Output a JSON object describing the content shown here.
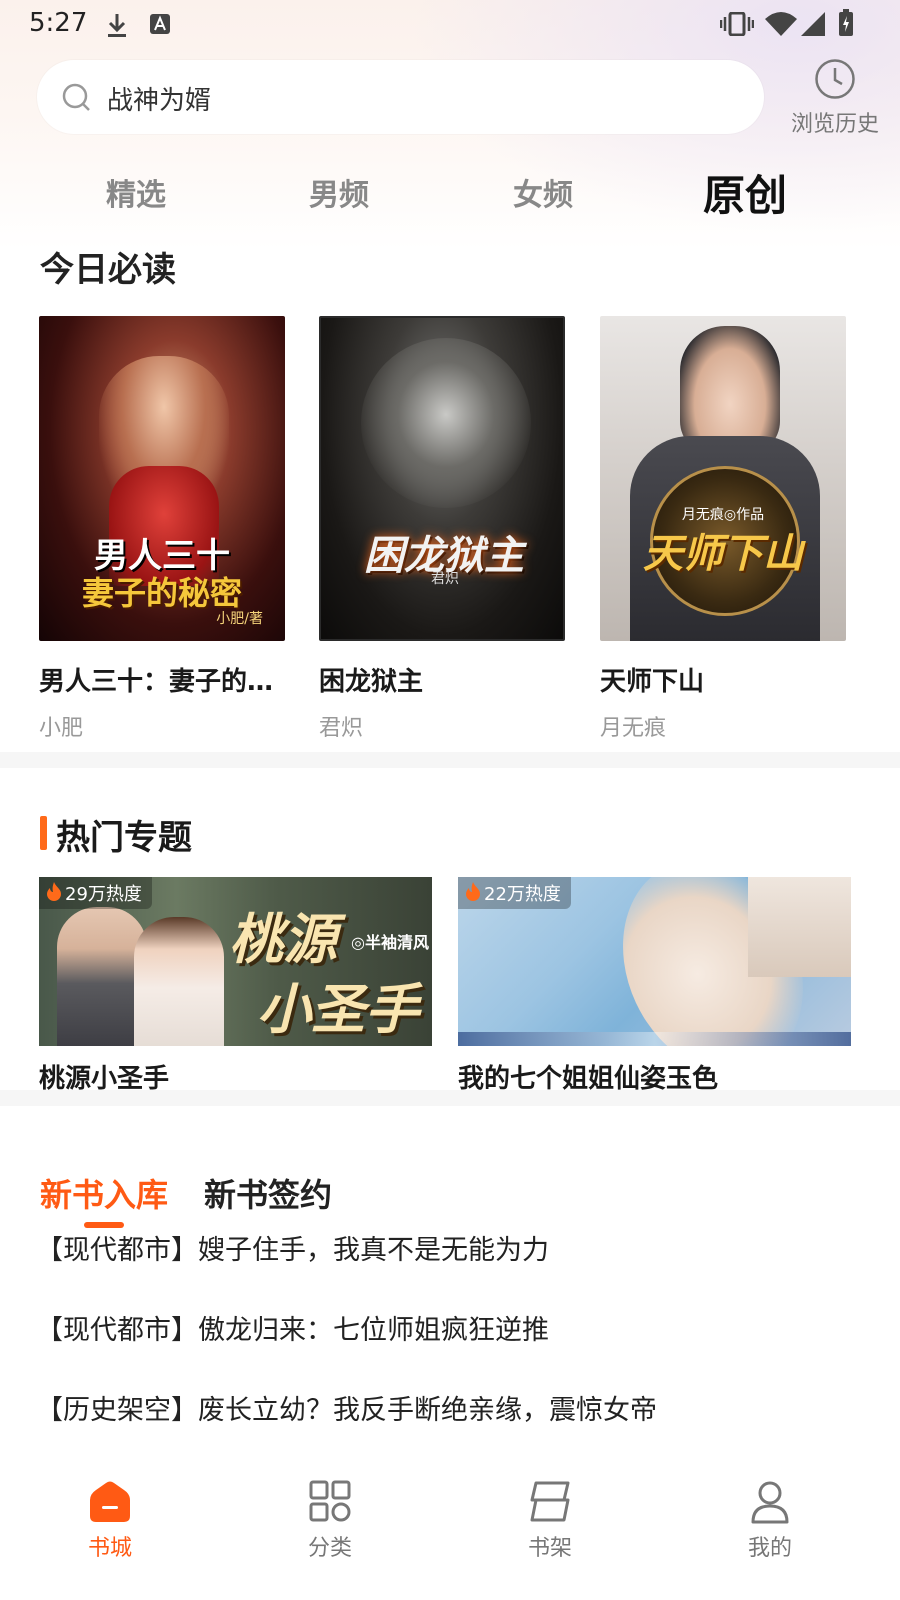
{
  "status_bar": {
    "time": "5:27",
    "left_icons": [
      "download-icon",
      "font-a-icon"
    ],
    "right_icons": [
      "vibrate-icon",
      "wifi-icon",
      "signal-icon",
      "battery-icon"
    ]
  },
  "search": {
    "query": "战神为婿",
    "icon": "search-icon"
  },
  "history": {
    "icon": "clock-icon",
    "label": "浏览历史"
  },
  "channel_tabs": [
    {
      "label": "精选",
      "active": false
    },
    {
      "label": "男频",
      "active": false
    },
    {
      "label": "女频",
      "active": false
    },
    {
      "label": "原创",
      "active": true
    }
  ],
  "today_reads": {
    "title": "今日必读",
    "books": [
      {
        "title": "男人三十：妻子的秘密",
        "author": "小肥",
        "cover_text_top": "男人三十",
        "cover_text_bottom": "妻子的秘密",
        "cover_credit": "小肥/著"
      },
      {
        "title": "困龙狱主",
        "author": "君炽",
        "cover_text_top": "困龙狱主",
        "cover_text_bottom": "",
        "cover_credit": "君炽"
      },
      {
        "title": "天师下山",
        "author": "月无痕",
        "cover_text_top": "天师下山",
        "cover_text_bottom": "",
        "cover_credit": "月无痕◎作品"
      }
    ]
  },
  "hot_topics": {
    "title": "热门专题",
    "items": [
      {
        "name": "桃源小圣手",
        "heat": "29万热度",
        "banner_text_top": "桃源",
        "banner_text_bottom": "小圣手",
        "banner_credit": "◎半袖清风"
      },
      {
        "name": "我的七个姐姐仙姿玉色",
        "heat": "22万热度",
        "banner_text_top": "",
        "banner_text_bottom": "",
        "banner_credit": ""
      }
    ]
  },
  "new_books": {
    "tabs": [
      {
        "label": "新书入库",
        "active": true
      },
      {
        "label": "新书签约",
        "active": false
      }
    ],
    "list": [
      "【现代都市】嫂子住手，我真不是无能为力",
      "【现代都市】傲龙归来：七位师姐疯狂逆推",
      "【历史架空】废长立幼？我反手断绝亲缘，震惊女帝"
    ]
  },
  "bottom_nav": [
    {
      "label": "书城",
      "icon": "home-icon",
      "active": true
    },
    {
      "label": "分类",
      "icon": "grid-icon",
      "active": false
    },
    {
      "label": "书架",
      "icon": "bookshelf-icon",
      "active": false
    },
    {
      "label": "我的",
      "icon": "profile-icon",
      "active": false
    }
  ],
  "colors": {
    "accent": "#ff5a14",
    "divider": "#f6f6f6"
  }
}
